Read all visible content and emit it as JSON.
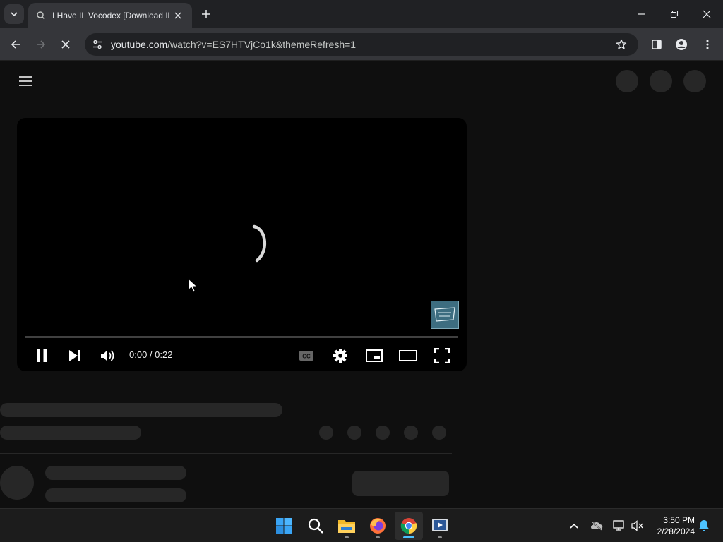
{
  "browser": {
    "tab": {
      "title": "I Have IL Vocodex [Download Il"
    },
    "address_bar": {
      "host": "youtube.com",
      "path": "/watch?v=ES7HTVjCo1k&themeRefresh=1"
    }
  },
  "player": {
    "time_display": "0:00 / 0:22",
    "progress_fraction": 0.0,
    "state": "loading"
  },
  "taskbar": {
    "clock_time": "3:50 PM",
    "clock_date": "2/28/2024",
    "apps": [
      "start-icon",
      "search-icon",
      "file-explorer-icon",
      "firefox-icon",
      "chrome-icon",
      "media-player-icon"
    ],
    "active_app": "chrome-icon"
  },
  "colors": {
    "page_background": "#0f0f0f",
    "skeleton": "#272727",
    "browser_frame": "#202124",
    "toolbar": "#35363a",
    "taskbar_accent": "#4cc2ff",
    "progress": "#ff0000"
  }
}
